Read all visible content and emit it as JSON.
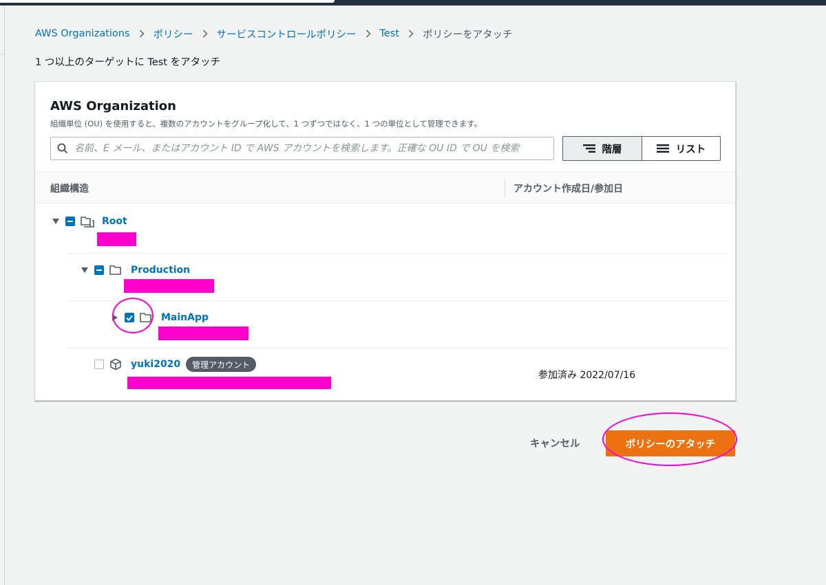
{
  "breadcrumb": {
    "items": [
      "AWS Organizations",
      "ポリシー",
      "サービスコントロールポリシー",
      "Test"
    ],
    "current": "ポリシーをアタッチ"
  },
  "subtitle": "1 つ以上のターゲットに Test をアタッチ",
  "panel": {
    "title": "AWS Organization",
    "description": "組織単位 (OU) を使用すると、複数のアカウントをグループ化して、1 つずつではなく、1 つの単位として管理できます。",
    "search_placeholder": "名前、E メール、またはアカウント ID で AWS アカウントを検索します。正確な OU ID で OU を検索",
    "view_toggle": {
      "hierarchy": "階層",
      "list": "リスト",
      "selected": "hierarchy"
    }
  },
  "table": {
    "columns": [
      "組織構造",
      "アカウント作成日/参加日"
    ],
    "rows": [
      {
        "name": "Root",
        "type": "root",
        "expanded": true,
        "selection": "partial"
      },
      {
        "name": "Production",
        "type": "ou",
        "expanded": true,
        "selection": "partial"
      },
      {
        "name": "MainApp",
        "type": "ou",
        "expanded": false,
        "selection": "checked"
      },
      {
        "name": "yuki2020",
        "type": "account",
        "selection": "unchecked",
        "badge": "管理アカウント",
        "joined": "参加済み 2022/07/16"
      }
    ]
  },
  "actions": {
    "cancel": "キャンセル",
    "attach": "ポリシーのアタッチ"
  },
  "colors": {
    "accent": "#0073bb",
    "primary_button": "#ec7211",
    "annotation": "#ff00cc"
  }
}
